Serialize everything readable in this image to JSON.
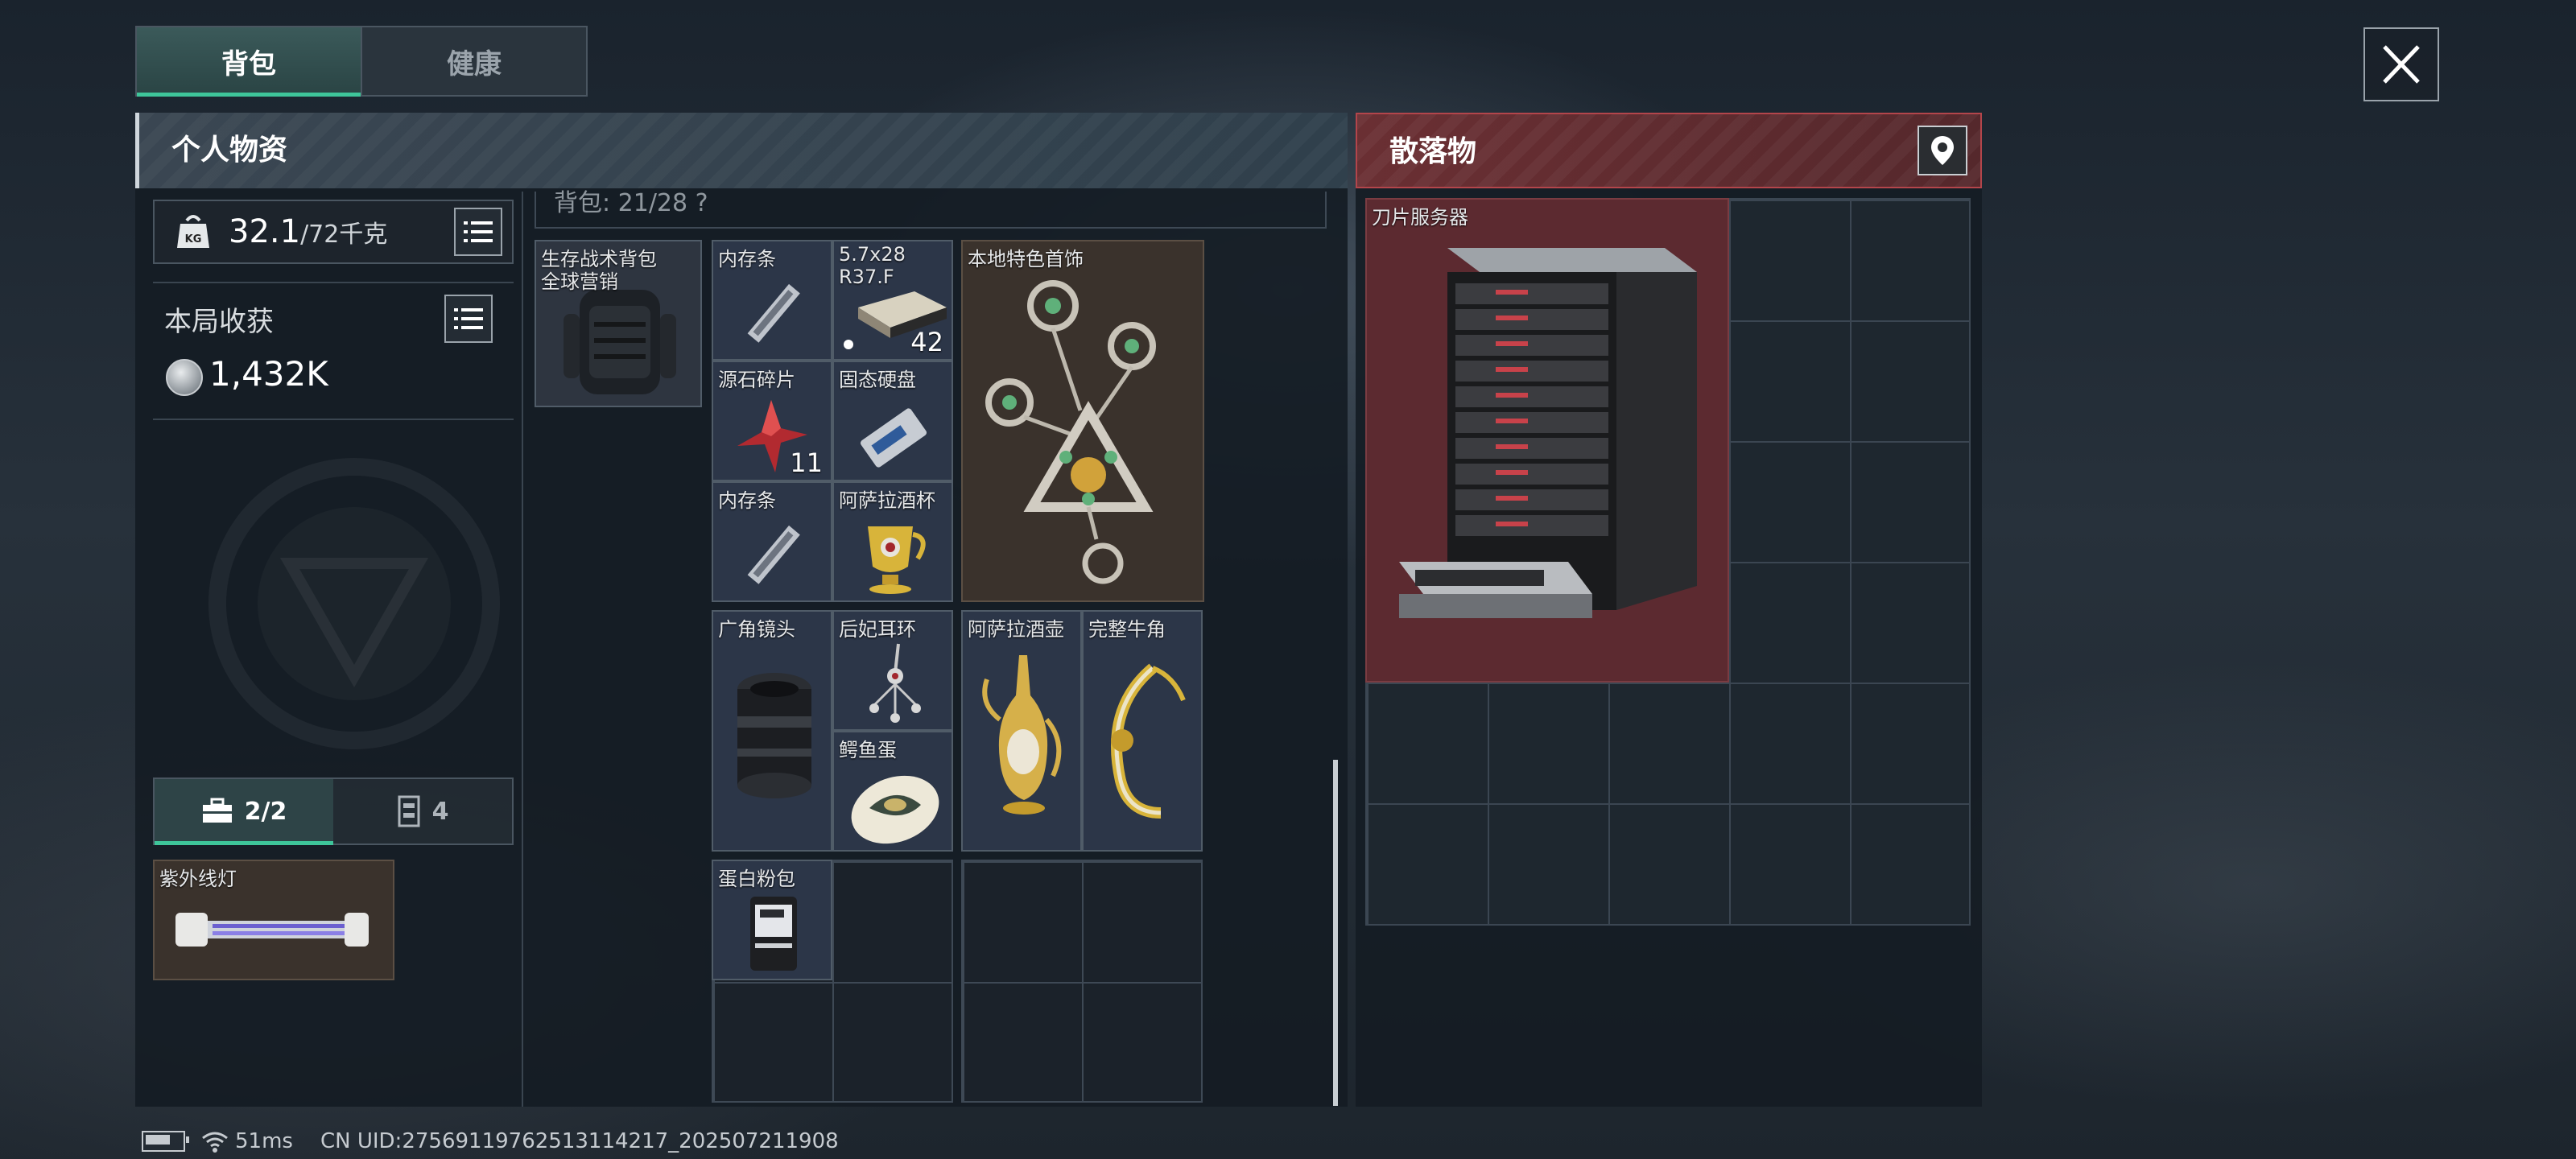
{
  "tabs": [
    {
      "label": "背包",
      "active": true
    },
    {
      "label": "健康",
      "active": false
    }
  ],
  "personal": {
    "title": "个人物资",
    "weight": {
      "current": "32.1",
      "max": "/72千克"
    },
    "harvest_label": "本局收获",
    "harvest_value": "1,432K",
    "backpack_summary": "背包: 21/28 ?",
    "sub_tabs": [
      {
        "label": "2/2",
        "icon": "toolbox-icon",
        "active": true
      },
      {
        "label": "4",
        "icon": "vest-icon",
        "active": false
      }
    ],
    "tool_item": {
      "name": "紫外线灯"
    }
  },
  "backpack": {
    "name": "生存战术背包",
    "subname": "全球营销"
  },
  "items": {
    "memory1": {
      "name": "内存条"
    },
    "ammo": {
      "name": "5.7x28",
      "subname": "R37.F",
      "count": "42"
    },
    "jewelry": {
      "name": "本地特色首饰"
    },
    "shard": {
      "name": "源石碎片",
      "count": "11"
    },
    "ssd": {
      "name": "固态硬盘"
    },
    "memory2": {
      "name": "内存条"
    },
    "cup": {
      "name": "阿萨拉酒杯"
    },
    "lens": {
      "name": "广角镜头"
    },
    "earring": {
      "name": "后妃耳环"
    },
    "egg": {
      "name": "鳄鱼蛋"
    },
    "pot": {
      "name": "阿萨拉酒壶"
    },
    "horn": {
      "name": "完整牛角"
    },
    "protein": {
      "name": "蛋白粉包"
    }
  },
  "loot": {
    "title": "散落物",
    "item": {
      "name": "刀片服务器"
    }
  },
  "status": {
    "ping": "51ms",
    "uid": "CN UID:27569119762513114217_202507211908"
  },
  "colors": {
    "accent": "#3ec59a",
    "loot_red": "#b3454b",
    "panel_bg": "#141c24"
  }
}
